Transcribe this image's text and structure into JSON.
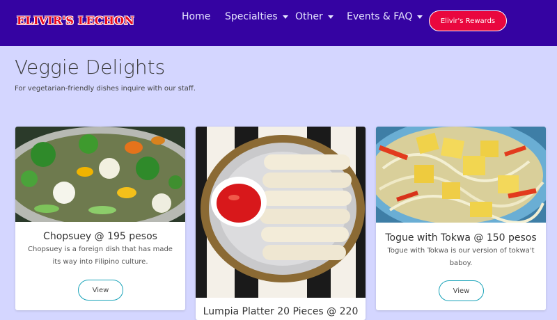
{
  "brand": "ELIVIR'S LECHON",
  "nav": {
    "home": "Home",
    "specialties": "Specialties",
    "other": "Other",
    "events": "Events & FAQ",
    "rewards": "Elivir's Rewards"
  },
  "page": {
    "title": "Veggie Delights",
    "subtitle": "For vegetarian-friendly dishes inquire with our staff."
  },
  "cards": [
    {
      "title": "Chopsuey @ 195 pesos",
      "text": "Chopsuey is a foreign dish that has made its way into Filipino culture.",
      "button": "View"
    },
    {
      "title": "Lumpia Platter 20 Pieces @ 220"
    },
    {
      "title": "Togue with Tokwa @ 150 pesos",
      "text": "Togue with Tokwa is our version of tokwa't baboy.",
      "button": "View"
    }
  ]
}
